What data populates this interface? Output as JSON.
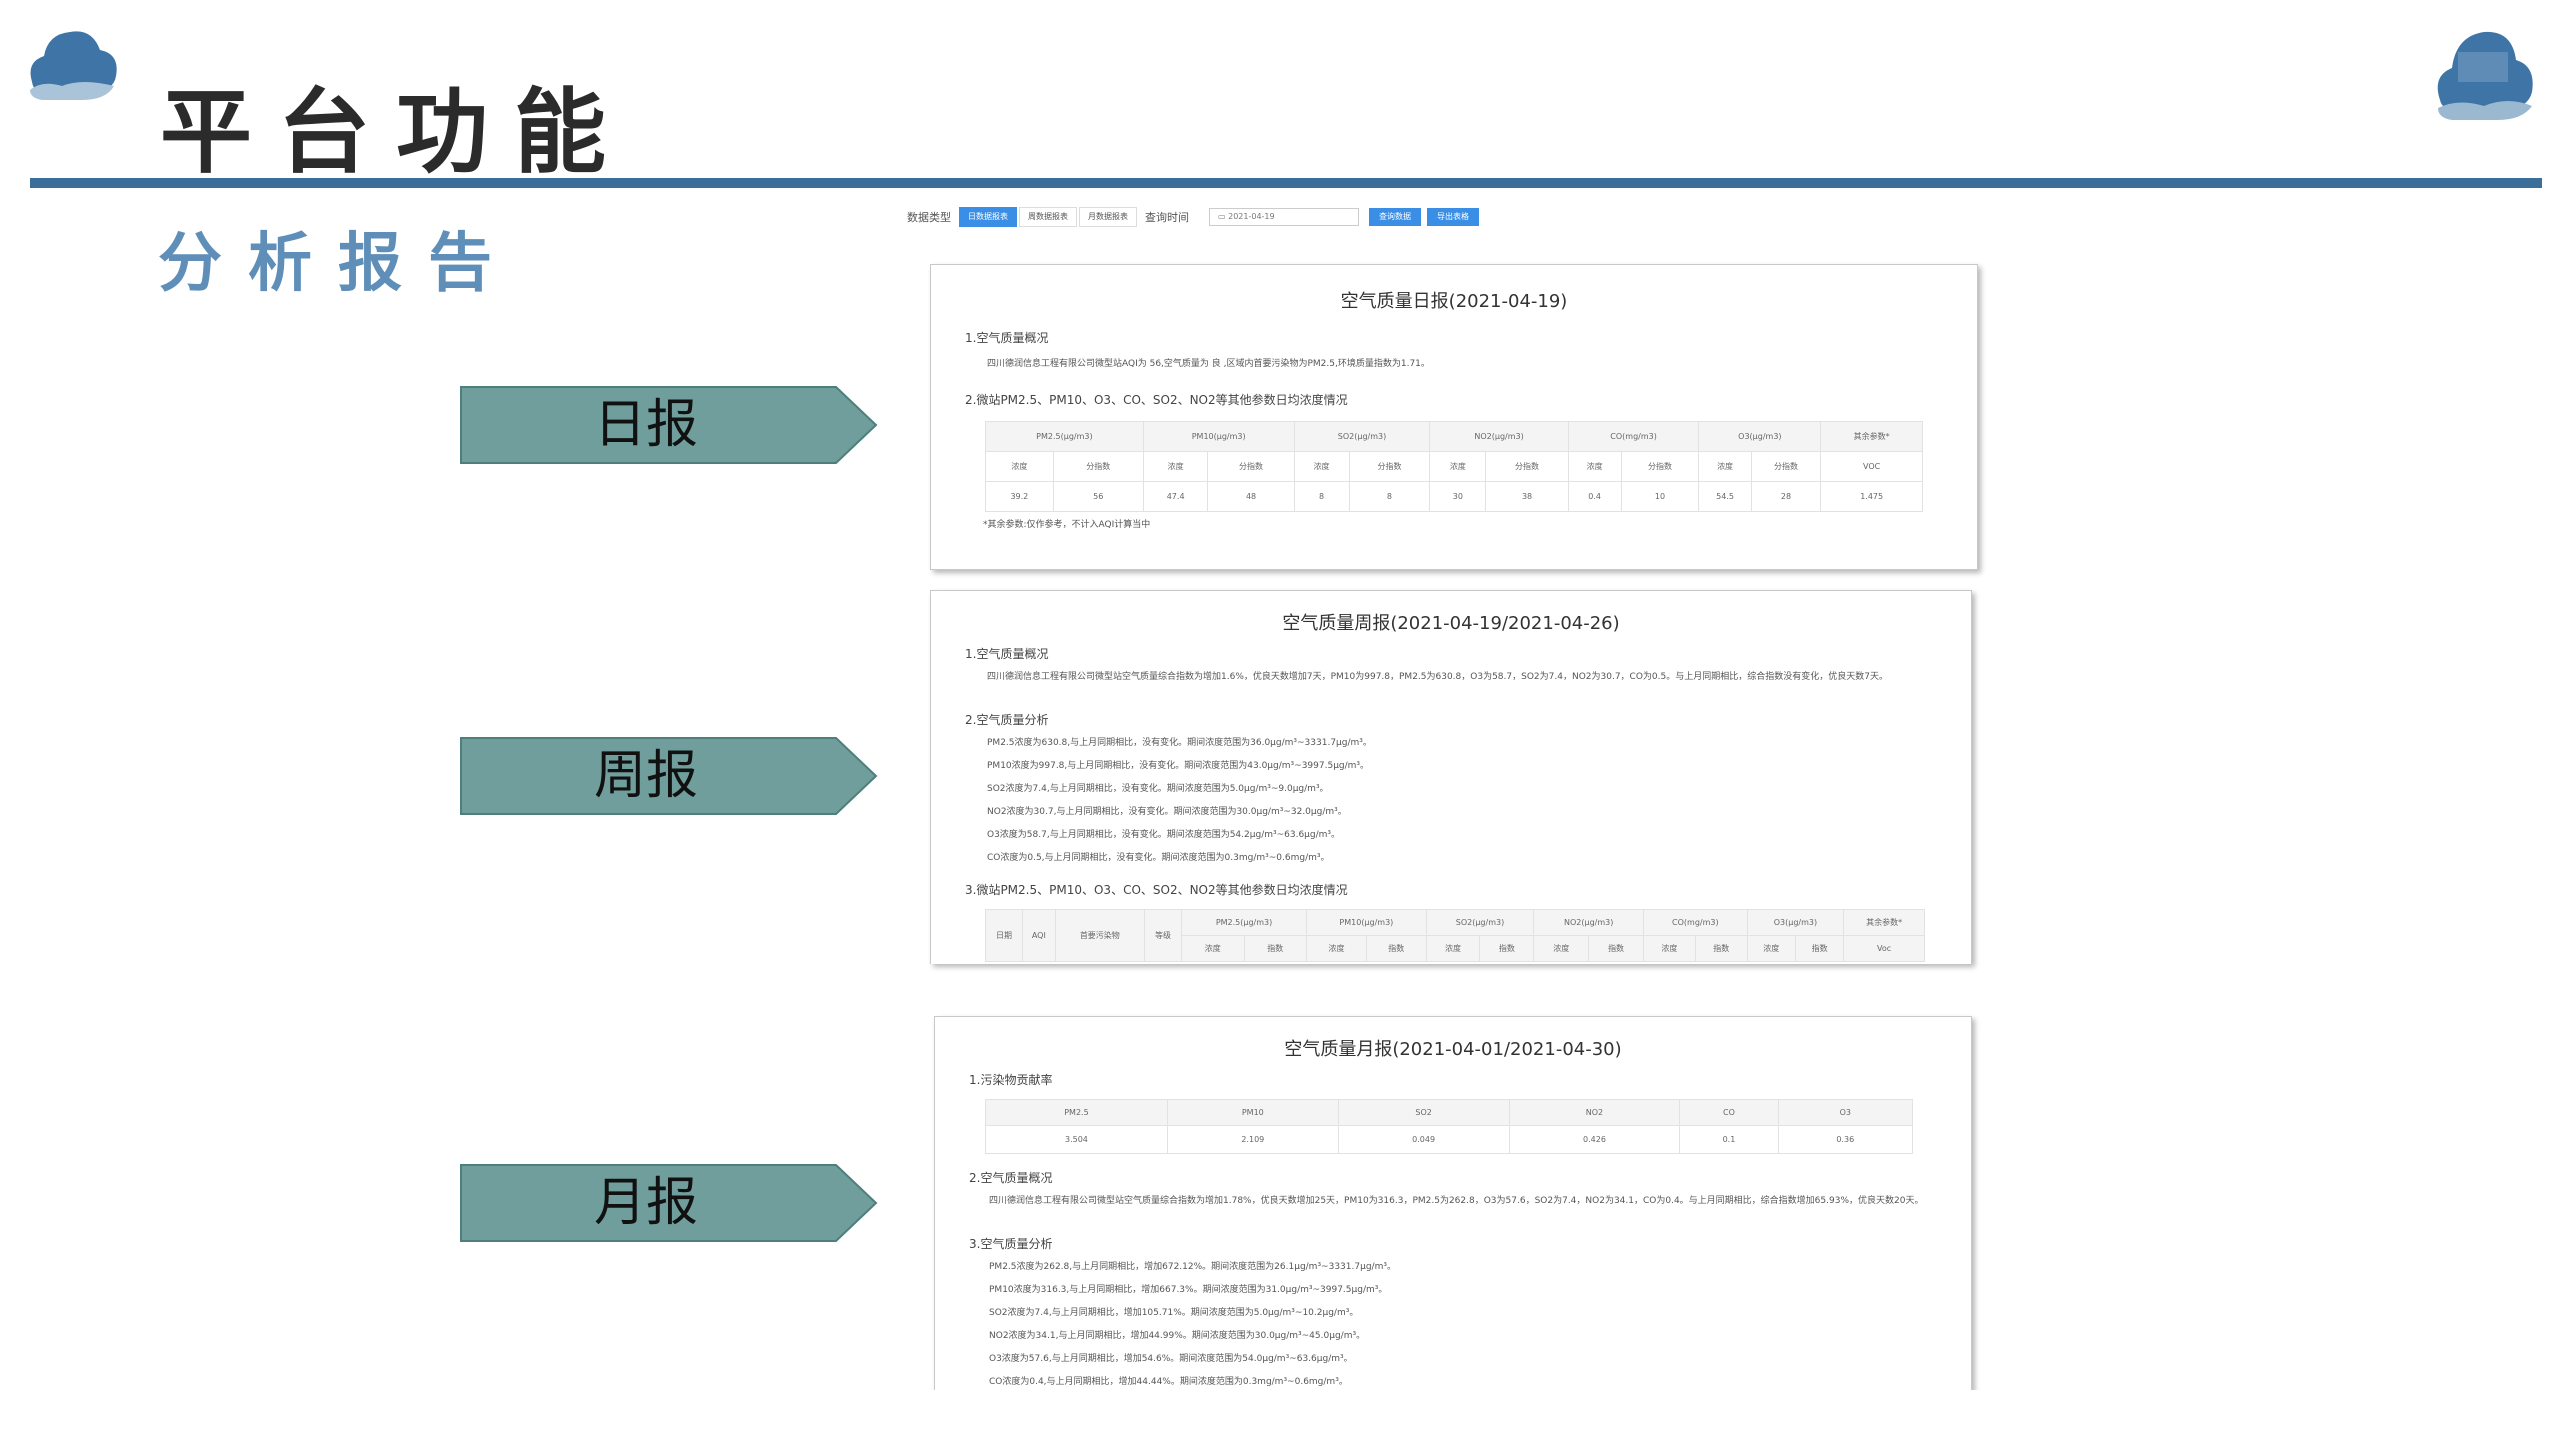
{
  "header": {
    "title": "平台功能",
    "subtitle": "分析报告"
  },
  "arrows": {
    "daily": "日报",
    "weekly": "周报",
    "monthly": "月报"
  },
  "toolbar": {
    "data_type_label": "数据类型",
    "tabs": [
      "日数据报表",
      "周数据报表",
      "月数据报表"
    ],
    "query_time_label": "查询时间",
    "date_value": "2021-04-19",
    "query_button": "查询数据",
    "export_button": "导出表格"
  },
  "daily": {
    "title": "空气质量日报(2021-04-19)",
    "sec1": "1.空气质量概况",
    "p1": "四川德润信息工程有限公司微型站AQI为 56,空气质量为 良 ,区域内首要污染物为PM2.5,环境质量指数为1.71。",
    "sec2": "2.微站PM2.5、PM10、O3、CO、SO2、NO2等其他参数日均浓度情况",
    "headers": [
      "PM2.5(μg/m3)",
      "PM10(μg/m3)",
      "SO2(μg/m3)",
      "NO2(μg/m3)",
      "CO(mg/m3)",
      "O3(μg/m3)",
      "其余参数*"
    ],
    "sub": [
      "浓度",
      "分指数",
      "浓度",
      "分指数",
      "浓度",
      "分指数",
      "浓度",
      "分指数",
      "浓度",
      "分指数",
      "浓度",
      "分指数",
      "VOC"
    ],
    "values": [
      "39.2",
      "56",
      "47.4",
      "48",
      "8",
      "8",
      "30",
      "38",
      "0.4",
      "10",
      "54.5",
      "28",
      "1.475"
    ],
    "note": "*其余参数:仅作参考，不计入AQI计算当中"
  },
  "weekly": {
    "title": "空气质量周报(2021-04-19/2021-04-26)",
    "sec1": "1.空气质量概况",
    "p1": "四川德润信息工程有限公司微型站空气质量综合指数为增加1.6%，优良天数增加7天，PM10为997.8，PM2.5为630.8，O3为58.7，SO2为7.4，NO2为30.7，CO为0.5。与上月同期相比，综合指数没有变化，优良天数7天。",
    "sec2": "2.空气质量分析",
    "lines": [
      "PM2.5浓度为630.8,与上月同期相比，没有变化。期间浓度范围为36.0μg/m³~3331.7μg/m³。",
      "PM10浓度为997.8,与上月同期相比，没有变化。期间浓度范围为43.0μg/m³~3997.5μg/m³。",
      "SO2浓度为7.4,与上月同期相比，没有变化。期间浓度范围为5.0μg/m³~9.0μg/m³。",
      "NO2浓度为30.7,与上月同期相比，没有变化。期间浓度范围为30.0μg/m³~32.0μg/m³。",
      "O3浓度为58.7,与上月同期相比，没有变化。期间浓度范围为54.2μg/m³~63.6μg/m³。",
      "CO浓度为0.5,与上月同期相比，没有变化。期间浓度范围为0.3mg/m³~0.6mg/m³。"
    ],
    "sec3": "3.微站PM2.5、PM10、O3、CO、SO2、NO2等其他参数日均浓度情况",
    "headers_left": [
      "日期",
      "AQI",
      "首要污染物",
      "等级"
    ],
    "headers": [
      "PM2.5(μg/m3)",
      "PM10(μg/m3)",
      "SO2(μg/m3)",
      "NO2(μg/m3)",
      "CO(mg/m3)",
      "O3(μg/m3)",
      "其余参数*"
    ],
    "sub": [
      "浓度",
      "指数",
      "浓度",
      "指数",
      "浓度",
      "指数",
      "浓度",
      "指数",
      "浓度",
      "指数",
      "浓度",
      "指数",
      "Voc"
    ]
  },
  "monthly": {
    "title": "空气质量月报(2021-04-01/2021-04-30)",
    "sec1": "1.污染物贡献率",
    "headers": [
      "PM2.5",
      "PM10",
      "SO2",
      "NO2",
      "CO",
      "O3"
    ],
    "values": [
      "3.504",
      "2.109",
      "0.049",
      "0.426",
      "0.1",
      "0.36"
    ],
    "sec2": "2.空气质量概况",
    "p1": "四川德润信息工程有限公司微型站空气质量综合指数为增加1.78%，优良天数增加25天，PM10为316.3，PM2.5为262.8，O3为57.6，SO2为7.4，NO2为34.1，CO为0.4。与上月同期相比，综合指数增加65.93%，优良天数20天。",
    "sec3": "3.空气质量分析",
    "lines": [
      "PM2.5浓度为262.8,与上月同期相比，增加672.12%。期间浓度范围为26.1μg/m³~3331.7μg/m³。",
      "PM10浓度为316.3,与上月同期相比，增加667.3%。期间浓度范围为31.0μg/m³~3997.5μg/m³。",
      "SO2浓度为7.4,与上月同期相比，增加105.71%。期间浓度范围为5.0μg/m³~10.2μg/m³。",
      "NO2浓度为34.1,与上月同期相比，增加44.99%。期间浓度范围为30.0μg/m³~45.0μg/m³。",
      "O3浓度为57.6,与上月同期相比，增加54.6%。期间浓度范围为54.0μg/m³~63.6μg/m³。",
      "CO浓度为0.4,与上月同期相比，增加44.44%。期间浓度范围为0.3mg/m³~0.6mg/m³。"
    ]
  },
  "colors": {
    "accent": "#3b6e99",
    "subtitle": "#5f8fb8",
    "arrow_fill": "#6f9e9c",
    "button_blue": "#3a8ee6"
  },
  "icons": [
    "cloud-icon-left",
    "cloud-icon-right"
  ]
}
